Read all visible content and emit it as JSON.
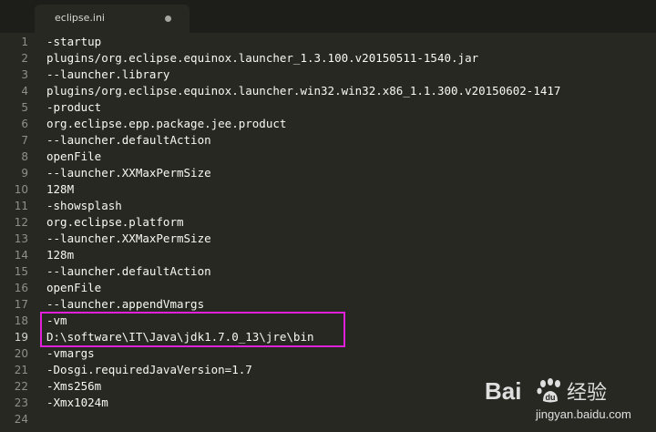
{
  "tab": {
    "title": "eclipse.ini"
  },
  "lines": [
    {
      "num": "1",
      "text": "-startup"
    },
    {
      "num": "2",
      "text": "plugins/org.eclipse.equinox.launcher_1.3.100.v20150511-1540.jar"
    },
    {
      "num": "3",
      "text": "--launcher.library"
    },
    {
      "num": "4",
      "text": "plugins/org.eclipse.equinox.launcher.win32.win32.x86_1.1.300.v20150602-1417"
    },
    {
      "num": "5",
      "text": "-product"
    },
    {
      "num": "6",
      "text": "org.eclipse.epp.package.jee.product"
    },
    {
      "num": "7",
      "text": "--launcher.defaultAction"
    },
    {
      "num": "8",
      "text": "openFile"
    },
    {
      "num": "9",
      "text": "--launcher.XXMaxPermSize"
    },
    {
      "num": "10",
      "text": "128M"
    },
    {
      "num": "11",
      "text": "-showsplash"
    },
    {
      "num": "12",
      "text": "org.eclipse.platform"
    },
    {
      "num": "13",
      "text": "--launcher.XXMaxPermSize"
    },
    {
      "num": "14",
      "text": "128m"
    },
    {
      "num": "15",
      "text": "--launcher.defaultAction"
    },
    {
      "num": "16",
      "text": "openFile"
    },
    {
      "num": "17",
      "text": "--launcher.appendVmargs"
    },
    {
      "num": "18",
      "text": "-vm"
    },
    {
      "num": "19",
      "text": "D:\\software\\IT\\Java\\jdk1.7.0_13\\jre\\bin"
    },
    {
      "num": "20",
      "text": "-vmargs"
    },
    {
      "num": "21",
      "text": "-Dosgi.requiredJavaVersion=1.7"
    },
    {
      "num": "22",
      "text": "-Xms256m"
    },
    {
      "num": "23",
      "text": "-Xmx1024m"
    },
    {
      "num": "24",
      "text": ""
    }
  ],
  "current_line": "19",
  "colors": {
    "background": "#272822",
    "tabbar": "#1d1e19",
    "text": "#f8f8f2",
    "gutter": "#8f908a",
    "highlight_box": "#e021d9"
  },
  "watermark": {
    "logo_text": "Bai",
    "logo_cn": "经验",
    "url": "jingyan.baidu.com"
  }
}
